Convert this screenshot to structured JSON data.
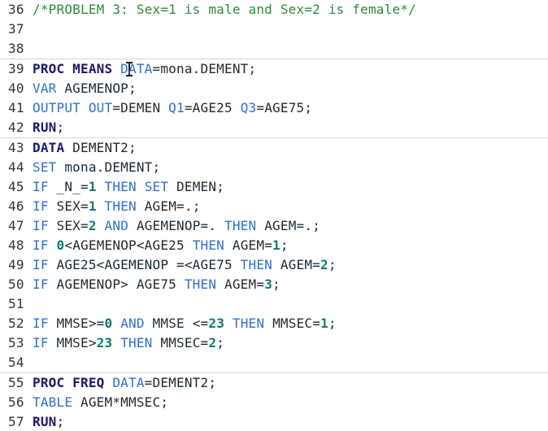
{
  "editor": {
    "lines": [
      {
        "num": "36",
        "sep": false,
        "tokens": [
          {
            "t": "c",
            "v": "/*PROBLEM 3: Sex=1 is male and Sex=2 is female*/"
          }
        ]
      },
      {
        "num": "37",
        "sep": false,
        "tokens": []
      },
      {
        "num": "38",
        "sep": true,
        "tokens": []
      },
      {
        "num": "39",
        "sep": false,
        "tokens": [
          {
            "t": "k",
            "v": "PROC MEANS"
          },
          {
            "t": "x",
            "v": " "
          },
          {
            "t": "f",
            "v": "DATA"
          },
          {
            "t": "x",
            "v": "=mona.DEMENT;"
          }
        ]
      },
      {
        "num": "40",
        "sep": false,
        "tokens": [
          {
            "t": "f",
            "v": "VAR"
          },
          {
            "t": "x",
            "v": " AGEMENOP;"
          }
        ]
      },
      {
        "num": "41",
        "sep": false,
        "tokens": [
          {
            "t": "f",
            "v": "OUTPUT OUT"
          },
          {
            "t": "x",
            "v": "=DEMEN "
          },
          {
            "t": "f",
            "v": "Q1"
          },
          {
            "t": "x",
            "v": "=AGE25 "
          },
          {
            "t": "f",
            "v": "Q3"
          },
          {
            "t": "x",
            "v": "=AGE75;"
          }
        ]
      },
      {
        "num": "42",
        "sep": true,
        "tokens": [
          {
            "t": "k",
            "v": "RUN"
          },
          {
            "t": "x",
            "v": ";"
          }
        ]
      },
      {
        "num": "43",
        "sep": false,
        "tokens": [
          {
            "t": "k",
            "v": "DATA"
          },
          {
            "t": "x",
            "v": " DEMENT2;"
          }
        ]
      },
      {
        "num": "44",
        "sep": false,
        "tokens": [
          {
            "t": "f",
            "v": "SET"
          },
          {
            "t": "x",
            "v": " mona.DEMENT;"
          }
        ]
      },
      {
        "num": "45",
        "sep": false,
        "tokens": [
          {
            "t": "f",
            "v": "IF"
          },
          {
            "t": "x",
            "v": " _N_="
          },
          {
            "t": "n",
            "v": "1"
          },
          {
            "t": "x",
            "v": " "
          },
          {
            "t": "f",
            "v": "THEN SET"
          },
          {
            "t": "x",
            "v": " DEMEN;"
          }
        ]
      },
      {
        "num": "46",
        "sep": false,
        "tokens": [
          {
            "t": "f",
            "v": "IF"
          },
          {
            "t": "x",
            "v": " SEX="
          },
          {
            "t": "n",
            "v": "1"
          },
          {
            "t": "x",
            "v": " "
          },
          {
            "t": "f",
            "v": "THEN"
          },
          {
            "t": "x",
            "v": " AGEM=.;"
          }
        ]
      },
      {
        "num": "47",
        "sep": false,
        "tokens": [
          {
            "t": "f",
            "v": "IF"
          },
          {
            "t": "x",
            "v": " SEX="
          },
          {
            "t": "n",
            "v": "2"
          },
          {
            "t": "x",
            "v": " "
          },
          {
            "t": "f",
            "v": "AND"
          },
          {
            "t": "x",
            "v": " AGEMENOP=. "
          },
          {
            "t": "f",
            "v": "THEN"
          },
          {
            "t": "x",
            "v": " AGEM=.;"
          }
        ]
      },
      {
        "num": "48",
        "sep": false,
        "tokens": [
          {
            "t": "f",
            "v": "IF"
          },
          {
            "t": "x",
            "v": " "
          },
          {
            "t": "n",
            "v": "0"
          },
          {
            "t": "x",
            "v": "<AGEMENOP<AGE25 "
          },
          {
            "t": "f",
            "v": "THEN"
          },
          {
            "t": "x",
            "v": " AGEM="
          },
          {
            "t": "n",
            "v": "1"
          },
          {
            "t": "x",
            "v": ";"
          }
        ]
      },
      {
        "num": "49",
        "sep": false,
        "tokens": [
          {
            "t": "f",
            "v": "IF"
          },
          {
            "t": "x",
            "v": " AGE25<AGEMENOP =<AGE75 "
          },
          {
            "t": "f",
            "v": "THEN"
          },
          {
            "t": "x",
            "v": " AGEM="
          },
          {
            "t": "n",
            "v": "2"
          },
          {
            "t": "x",
            "v": ";"
          }
        ]
      },
      {
        "num": "50",
        "sep": false,
        "tokens": [
          {
            "t": "f",
            "v": "IF"
          },
          {
            "t": "x",
            "v": " AGEMENOP> AGE75 "
          },
          {
            "t": "f",
            "v": "THEN"
          },
          {
            "t": "x",
            "v": " AGEM="
          },
          {
            "t": "n",
            "v": "3"
          },
          {
            "t": "x",
            "v": ";"
          }
        ]
      },
      {
        "num": "51",
        "sep": false,
        "tokens": []
      },
      {
        "num": "52",
        "sep": false,
        "tokens": [
          {
            "t": "f",
            "v": "IF"
          },
          {
            "t": "x",
            "v": " MMSE>="
          },
          {
            "t": "n",
            "v": "0"
          },
          {
            "t": "x",
            "v": " "
          },
          {
            "t": "f",
            "v": "AND"
          },
          {
            "t": "x",
            "v": " MMSE <="
          },
          {
            "t": "n",
            "v": "23"
          },
          {
            "t": "x",
            "v": " "
          },
          {
            "t": "f",
            "v": "THEN"
          },
          {
            "t": "x",
            "v": " MMSEC="
          },
          {
            "t": "n",
            "v": "1"
          },
          {
            "t": "x",
            "v": ";"
          }
        ]
      },
      {
        "num": "53",
        "sep": false,
        "tokens": [
          {
            "t": "f",
            "v": "IF"
          },
          {
            "t": "x",
            "v": " MMSE>"
          },
          {
            "t": "n",
            "v": "23"
          },
          {
            "t": "x",
            "v": " "
          },
          {
            "t": "f",
            "v": "THEN"
          },
          {
            "t": "x",
            "v": " MMSEC="
          },
          {
            "t": "n",
            "v": "2"
          },
          {
            "t": "x",
            "v": ";"
          }
        ]
      },
      {
        "num": "54",
        "sep": true,
        "tokens": []
      },
      {
        "num": "55",
        "sep": false,
        "tokens": [
          {
            "t": "k",
            "v": "PROC FREQ"
          },
          {
            "t": "x",
            "v": " "
          },
          {
            "t": "f",
            "v": "DATA"
          },
          {
            "t": "x",
            "v": "=DEMENT2;"
          }
        ]
      },
      {
        "num": "56",
        "sep": false,
        "tokens": [
          {
            "t": "f",
            "v": "TABLE"
          },
          {
            "t": "x",
            "v": " AGEM*MMSEC;"
          }
        ]
      },
      {
        "num": "57",
        "sep": true,
        "tokens": [
          {
            "t": "k",
            "v": "RUN"
          },
          {
            "t": "x",
            "v": ";"
          }
        ]
      }
    ]
  },
  "colors": {
    "comment": "#2e8b3a",
    "keyword": "#1a1a6e",
    "function": "#2f6fd0",
    "number": "#0f7a72",
    "text": "#1c2a34",
    "separator": "#d6d6d6"
  }
}
